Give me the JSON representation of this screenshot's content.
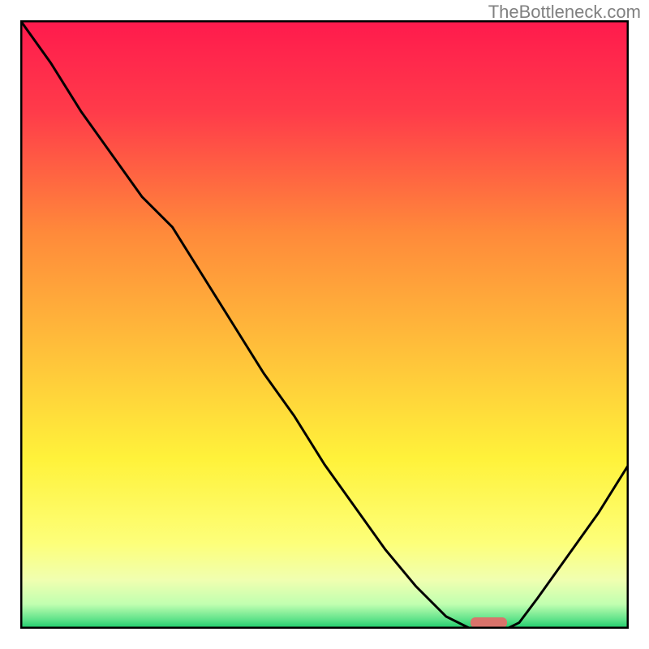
{
  "watermark": "TheBottleneck.com",
  "chart_data": {
    "type": "line",
    "title": "",
    "xlabel": "",
    "ylabel": "",
    "xlim": [
      0,
      100
    ],
    "ylim": [
      0,
      100
    ],
    "curve": {
      "description": "V-shaped bottleneck curve with minimum around x=76",
      "x": [
        0,
        5,
        10,
        15,
        20,
        25,
        30,
        35,
        40,
        45,
        50,
        55,
        60,
        65,
        70,
        74,
        76,
        80,
        82,
        85,
        90,
        95,
        100
      ],
      "y": [
        100,
        93,
        85,
        78,
        71,
        66,
        58,
        50,
        42,
        35,
        27,
        20,
        13,
        7,
        2,
        0,
        0,
        0,
        1,
        5,
        12,
        19,
        27
      ]
    },
    "marker": {
      "description": "optimal point marker (red pill)",
      "x_center": 77,
      "y": 0,
      "width": 6,
      "color": "#d9736b"
    },
    "background_gradient": {
      "type": "vertical",
      "stops": [
        {
          "pos": 0.0,
          "color": "#ff1a4d"
        },
        {
          "pos": 0.15,
          "color": "#ff3b4a"
        },
        {
          "pos": 0.35,
          "color": "#ff8a3a"
        },
        {
          "pos": 0.55,
          "color": "#ffc23a"
        },
        {
          "pos": 0.72,
          "color": "#fff23a"
        },
        {
          "pos": 0.86,
          "color": "#fdff7a"
        },
        {
          "pos": 0.92,
          "color": "#f0ffb0"
        },
        {
          "pos": 0.96,
          "color": "#c0ffb0"
        },
        {
          "pos": 0.985,
          "color": "#5fe28a"
        },
        {
          "pos": 1.0,
          "color": "#18c968"
        }
      ]
    },
    "frame_color": "#000000"
  }
}
